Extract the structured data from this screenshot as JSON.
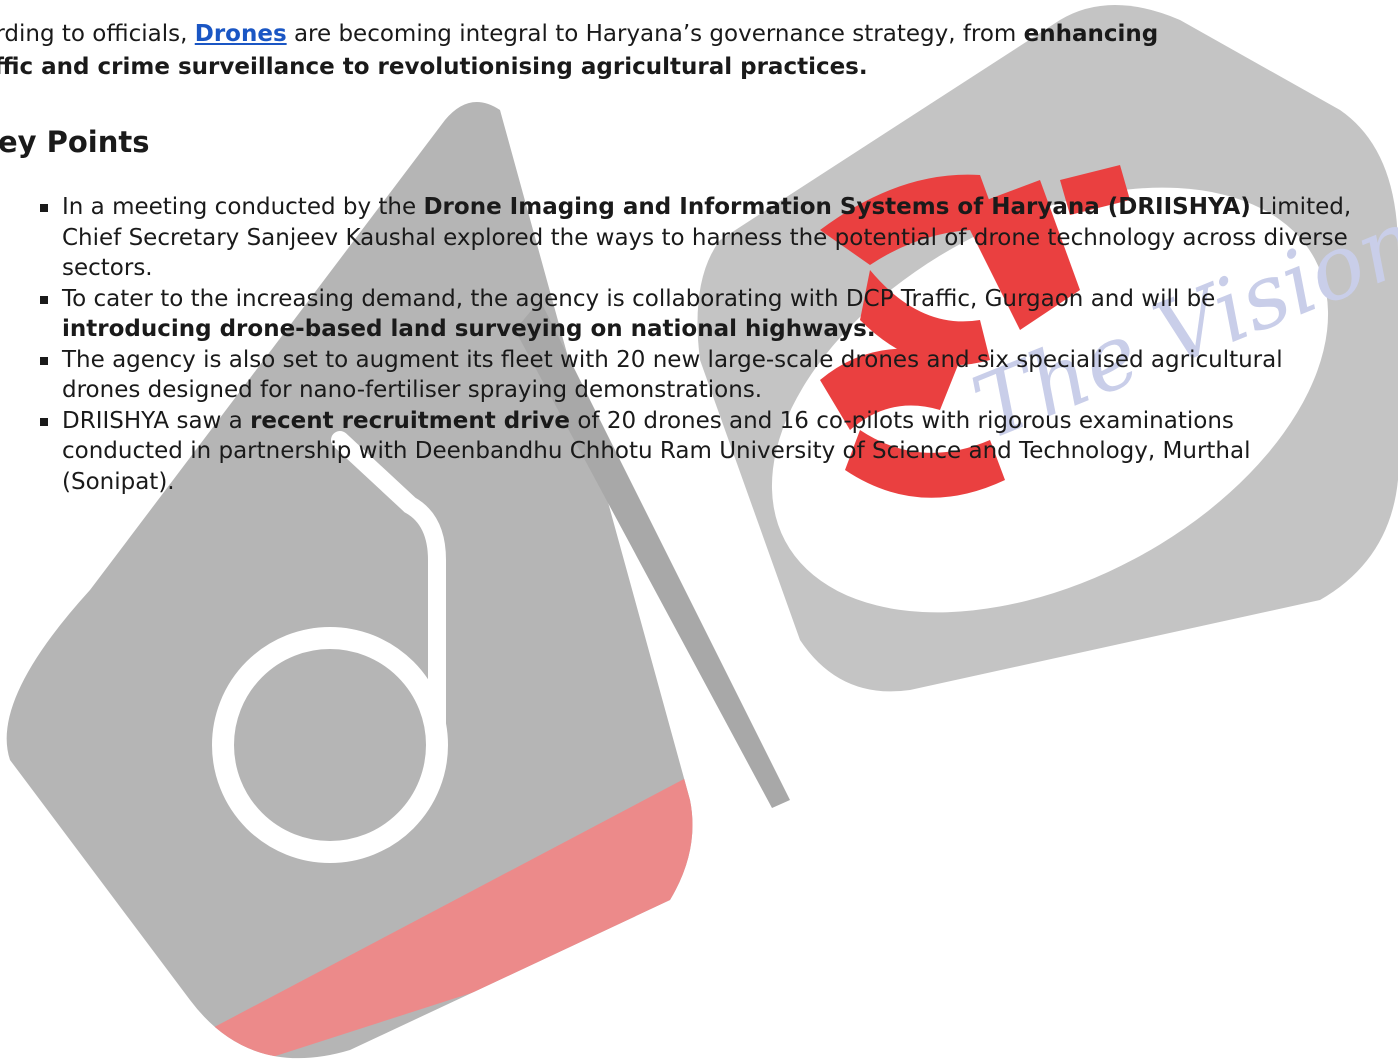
{
  "intro": {
    "prefix": "ccording to officials,",
    "link": "Drones",
    "middle": " are becoming integral to Haryana’s governance strategy, from ",
    "bold_1": "enhancing",
    "bold_2": "traffic and crime surveillance to revolutionising agricultural practices."
  },
  "heading": "Key Points",
  "points": [
    {
      "pre": "In a meeting conducted by the ",
      "bold": "Drone Imaging and Information Systems of Haryana (DRIISHYA)",
      "post": " Limited, Chief Secretary Sanjeev Kaushal explored the ways to harness the potential of drone technology across diverse sectors."
    },
    {
      "pre": "To cater to the increasing demand, the agency is collaborating with DCP Traffic, Gurgaon and will be ",
      "bold": "introducing drone-based land surveying on national highways.",
      "post": ""
    },
    {
      "pre": "The agency is also set to augment its fleet with 20 new large-scale drones and six specialised agricultural drones designed for nano-fertiliser spraying demonstrations.",
      "bold": "",
      "post": ""
    },
    {
      "pre": "DRIISHYA saw a ",
      "bold": "recent recruitment drive",
      "post": " of 20 drones and 16 co-pilots with rigorous examinations conducted in partnership with Deenbandhu Chhotu Ram University of Science and Technology, Murthal (Sonipat)."
    }
  ],
  "watermark": {
    "text": "The Vision",
    "colors": {
      "grey": "#a9a9a9",
      "red": "#e83a3a"
    }
  }
}
